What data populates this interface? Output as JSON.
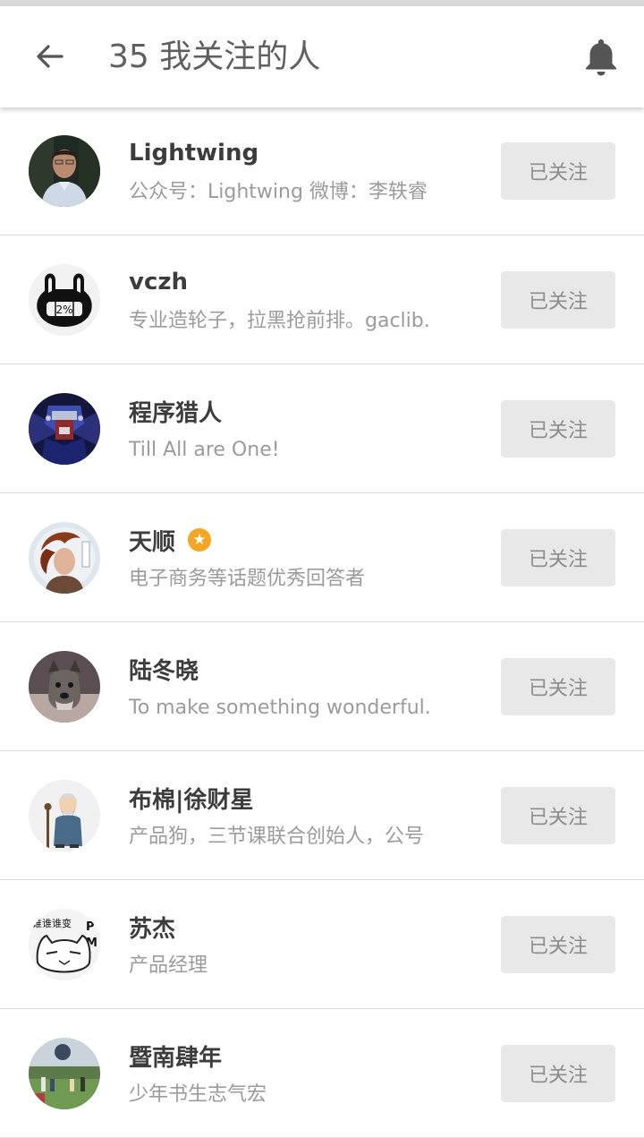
{
  "header": {
    "title": "35 我关注的人",
    "back_icon": "arrow-left-icon",
    "bell_icon": "bell-icon"
  },
  "colors": {
    "title": "#5f5f5f",
    "name": "#3c3c3c",
    "description": "#9b9b9b",
    "button_bg": "#e8e8e8",
    "button_text": "#8c8c8c",
    "badge": "#f5a623"
  },
  "users": [
    {
      "name": "Lightwing",
      "description": "公众号：Lightwing 微博：李轶睿",
      "button_label": "已关注",
      "badge": false
    },
    {
      "name": "vczh",
      "description": "专业造轮子，拉黑抢前排。gaclib.",
      "button_label": "已关注",
      "badge": false,
      "avatar_text": "2%"
    },
    {
      "name": "程序猎人",
      "description": "Till All are One!",
      "button_label": "已关注",
      "badge": false
    },
    {
      "name": "天顺",
      "description": "电子商务等话题优秀回答者",
      "button_label": "已关注",
      "badge": true,
      "badge_icon": "star-badge-icon"
    },
    {
      "name": "陆冬晓",
      "description": "To make something wonderful.",
      "button_label": "已关注",
      "badge": false
    },
    {
      "name": "布棉|徐财星",
      "description": "产品狗，三节课联合创始人，公号",
      "button_label": "已关注",
      "badge": false
    },
    {
      "name": "苏杰",
      "description": "产品经理",
      "button_label": "已关注",
      "badge": false,
      "avatar_text_1": "谁谁谁变",
      "avatar_text_2": "P",
      "avatar_text_3": "M"
    },
    {
      "name": "暨南肆年",
      "description": "少年书生志气宏",
      "button_label": "已关注",
      "badge": false
    }
  ]
}
